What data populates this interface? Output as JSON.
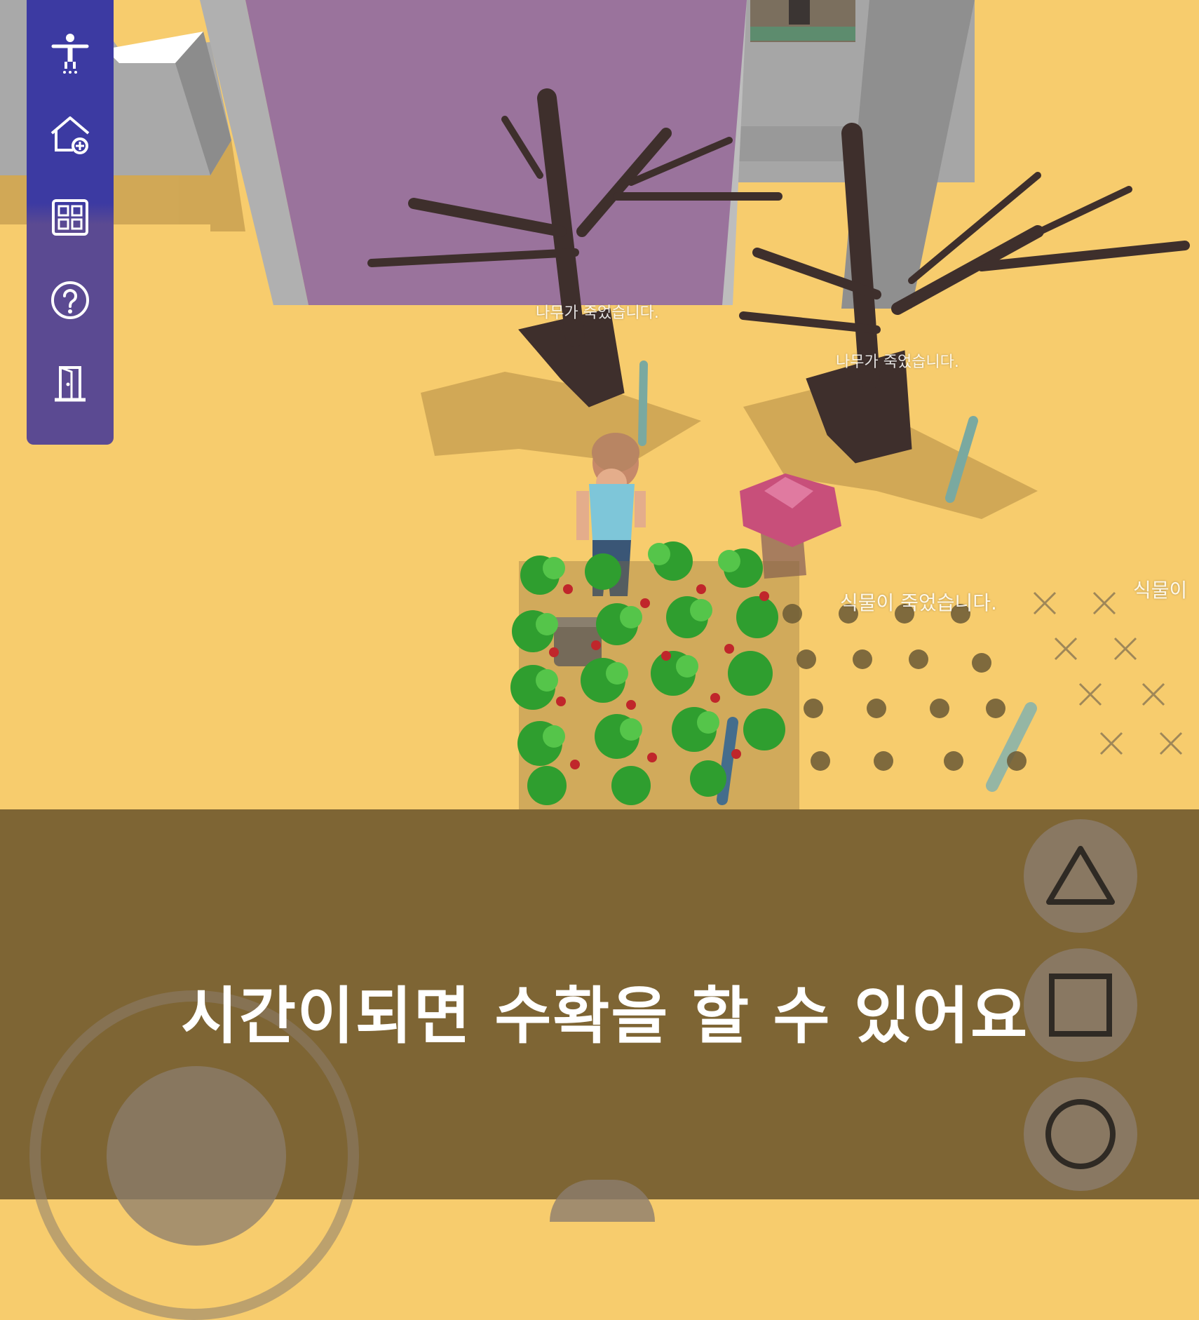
{
  "world_labels": {
    "tree_dead_1": "나무가 죽었습니다.",
    "tree_dead_2": "나무가 죽었습니다.",
    "plant_dead": "식물이 죽었습니다.",
    "plant_dead_partial": "식물이"
  },
  "caption": "시간이되면 수확을 할 수 있어요",
  "sidebar": {
    "items": [
      {
        "icon": "avatar-icon"
      },
      {
        "icon": "home-icon"
      },
      {
        "icon": "grid-menu-icon"
      },
      {
        "icon": "help-icon"
      },
      {
        "icon": "exit-door-icon"
      }
    ]
  },
  "controls": {
    "buttons": [
      {
        "icon": "triangle-icon"
      },
      {
        "icon": "square-icon"
      },
      {
        "icon": "circle-icon"
      }
    ]
  },
  "colors": {
    "ground": "#f7cc6d",
    "bottom_panel": "#7e6534",
    "sidebar": "#3c3aa2",
    "wall_purple": "#9a739c"
  }
}
